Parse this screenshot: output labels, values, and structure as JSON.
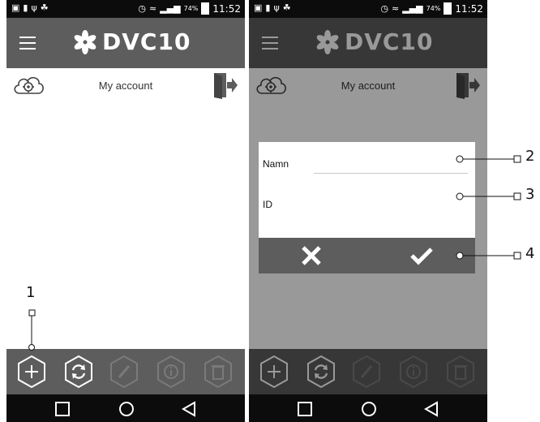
{
  "status_bar": {
    "battery_percent": "74%",
    "time": "11:52"
  },
  "app_bar": {
    "brand": "DVC10"
  },
  "account": {
    "title": "My account"
  },
  "dialog": {
    "name_label": "Namn",
    "name_value": "",
    "id_label": "ID"
  },
  "bottom_bar": {
    "buttons": [
      "add-icon",
      "sync-icon",
      "edit-icon",
      "info-icon",
      "delete-icon"
    ]
  },
  "nav_bar": {
    "buttons": [
      "recent-apps-icon",
      "home-icon",
      "back-icon"
    ]
  },
  "callouts": {
    "c1": "1",
    "c2": "2",
    "c3": "3",
    "c4": "4"
  },
  "colors": {
    "bar": "#5d5d5d",
    "status": "#0c0c0c",
    "disabled_icon": "#7a7a7a"
  }
}
